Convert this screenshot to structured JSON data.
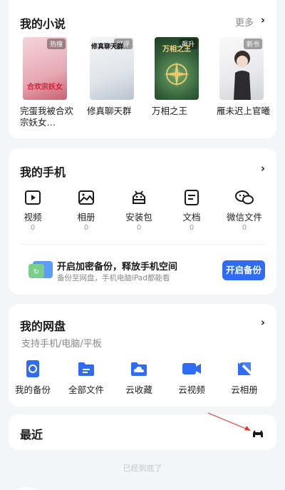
{
  "novels": {
    "title": "我的小说",
    "more": "更多",
    "books": [
      {
        "title": "完蛋我被合欢宗妖女…",
        "tag": "热搜",
        "cover_text": "合欢宗妖女"
      },
      {
        "title": "修真聊天群",
        "tag": "好评",
        "cover_text": "修真聊天群"
      },
      {
        "title": "万相之王",
        "tag": "飙升",
        "cover_text": "万相之王"
      },
      {
        "title": "雁未迟上官曦",
        "tag": "新书",
        "cover_text": ""
      }
    ]
  },
  "phone": {
    "title": "我的手机",
    "items": [
      {
        "label": "视频",
        "count": "0",
        "icon": "video-icon"
      },
      {
        "label": "相册",
        "count": "0",
        "icon": "photo-icon"
      },
      {
        "label": "安装包",
        "count": "0",
        "icon": "android-icon"
      },
      {
        "label": "文档",
        "count": "0",
        "icon": "document-icon"
      },
      {
        "label": "微信文件",
        "count": "0",
        "icon": "wechat-icon"
      }
    ],
    "backup_title": "开启加密备份，释放手机空间",
    "backup_sub": "备份至网盘，手机电脑iPad都能看",
    "backup_button": "开启备份"
  },
  "cloud": {
    "title": "我的网盘",
    "subtitle": "支持手机/电脑/平板",
    "items": [
      {
        "label": "我的备份",
        "icon": "backup-icon"
      },
      {
        "label": "全部文件",
        "icon": "folder-icon"
      },
      {
        "label": "云收藏",
        "icon": "cloud-favorite-icon"
      },
      {
        "label": "云视频",
        "icon": "cloud-video-icon"
      },
      {
        "label": "云相册",
        "icon": "cloud-album-icon"
      }
    ]
  },
  "recent": {
    "title": "最近"
  },
  "footer": {
    "end_text": "已经到底了"
  },
  "colors": {
    "accent": "#2f6bf3",
    "background": "#f4f5f7",
    "arrow": "#e03a3a"
  }
}
